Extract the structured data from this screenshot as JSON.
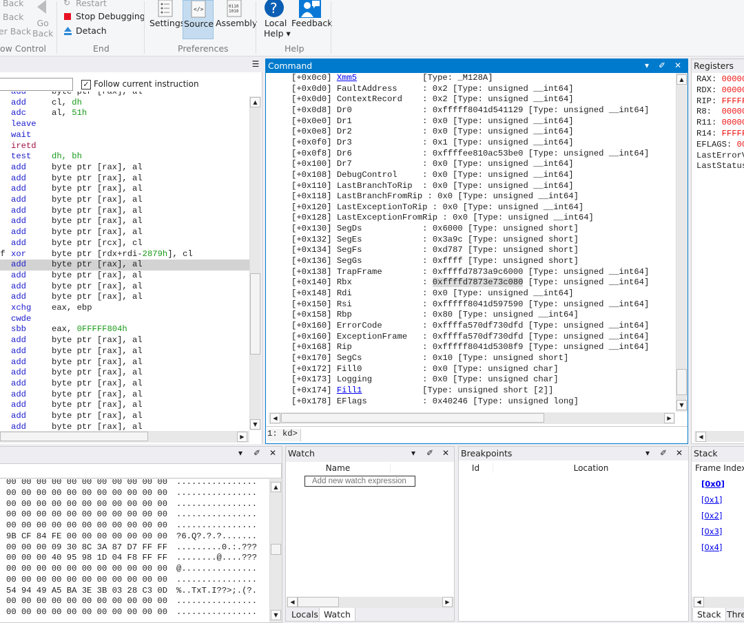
{
  "ribbon": {
    "flow_control": {
      "back1": "Back",
      "back2": "Back",
      "back3": "er Back",
      "go_back": "Go\nBack",
      "label": "ow Control"
    },
    "end": {
      "restart": "Restart",
      "stop": "Stop Debugging",
      "detach": "Detach",
      "label": "End"
    },
    "preferences": {
      "settings": "Settings",
      "source": "Source",
      "assembly": "Assembly",
      "label": "Preferences",
      "selected": "Source"
    },
    "help": {
      "local_help": "Local",
      "local_help2": "Help ▾",
      "feedback": "Feedback",
      "label": "Help"
    }
  },
  "disassembly": {
    "follow_label": "Follow current instruction",
    "follow_checked": true,
    "address_value": "",
    "highlight_index": 16,
    "rows": [
      {
        "p": "",
        "m": "add",
        "o": [
          [
            "byte ptr [rax], al",
            "n"
          ]
        ]
      },
      {
        "p": "",
        "m": "add",
        "o": [
          [
            "cl, ",
            "n"
          ],
          [
            "dh",
            "g"
          ]
        ]
      },
      {
        "p": "",
        "m": "adc",
        "o": [
          [
            "al, ",
            "n"
          ],
          [
            "51h",
            "g"
          ]
        ]
      },
      {
        "p": "",
        "m": "leave",
        "o": []
      },
      {
        "p": "",
        "m": "wait",
        "o": []
      },
      {
        "p": "",
        "m": "iretd",
        "k": "r",
        "o": []
      },
      {
        "p": "",
        "m": "test",
        "o": [
          [
            "dh, bh",
            "g"
          ]
        ]
      },
      {
        "p": "",
        "m": "add",
        "o": [
          [
            "byte ptr [rax], al",
            "n"
          ]
        ]
      },
      {
        "p": "",
        "m": "add",
        "o": [
          [
            "byte ptr [rax], al",
            "n"
          ]
        ]
      },
      {
        "p": "",
        "m": "add",
        "o": [
          [
            "byte ptr [rax], al",
            "n"
          ]
        ]
      },
      {
        "p": "",
        "m": "add",
        "o": [
          [
            "byte ptr [rax], al",
            "n"
          ]
        ]
      },
      {
        "p": "",
        "m": "add",
        "o": [
          [
            "byte ptr [rax], al",
            "n"
          ]
        ]
      },
      {
        "p": "",
        "m": "add",
        "o": [
          [
            "byte ptr [rax], al",
            "n"
          ]
        ]
      },
      {
        "p": "",
        "m": "add",
        "o": [
          [
            "byte ptr [rax], al",
            "n"
          ]
        ]
      },
      {
        "p": "",
        "m": "add",
        "o": [
          [
            "byte ptr [rcx], cl",
            "n"
          ]
        ]
      },
      {
        "p": "ff",
        "m": "xor",
        "o": [
          [
            "byte ptr [rdx+rdi-",
            "n"
          ],
          [
            "2879h",
            "g"
          ],
          [
            "], cl",
            "n"
          ]
        ]
      },
      {
        "p": "",
        "m": "add",
        "o": [
          [
            "byte ptr [rax], al",
            "n"
          ]
        ]
      },
      {
        "p": "",
        "m": "add",
        "o": [
          [
            "byte ptr [rax], al",
            "n"
          ]
        ]
      },
      {
        "p": "",
        "m": "add",
        "o": [
          [
            "byte ptr [rax], al",
            "n"
          ]
        ]
      },
      {
        "p": "",
        "m": "add",
        "o": [
          [
            "byte ptr [rax], al",
            "n"
          ]
        ]
      },
      {
        "p": "",
        "m": "xchg",
        "o": [
          [
            "eax, ebp",
            "n"
          ]
        ]
      },
      {
        "p": "",
        "m": "cwde",
        "o": []
      },
      {
        "p": "",
        "m": "sbb",
        "o": [
          [
            "eax, ",
            "n"
          ],
          [
            "0FFFFF804h",
            "g"
          ]
        ]
      },
      {
        "p": "",
        "m": "add",
        "o": [
          [
            "byte ptr [rax], al",
            "n"
          ]
        ]
      },
      {
        "p": "",
        "m": "add",
        "o": [
          [
            "byte ptr [rax], al",
            "n"
          ]
        ]
      },
      {
        "p": "",
        "m": "add",
        "o": [
          [
            "byte ptr [rax], al",
            "n"
          ]
        ]
      },
      {
        "p": "",
        "m": "add",
        "o": [
          [
            "byte ptr [rax], al",
            "n"
          ]
        ]
      },
      {
        "p": "",
        "m": "add",
        "o": [
          [
            "byte ptr [rax], al",
            "n"
          ]
        ]
      },
      {
        "p": "",
        "m": "add",
        "o": [
          [
            "byte ptr [rax], al",
            "n"
          ]
        ]
      },
      {
        "p": "",
        "m": "add",
        "o": [
          [
            "byte ptr [rax], al",
            "n"
          ]
        ]
      },
      {
        "p": "",
        "m": "add",
        "o": [
          [
            "byte ptr [rax], al",
            "n"
          ]
        ]
      },
      {
        "p": "",
        "m": "add",
        "o": [
          [
            "byte ptr [rax], al",
            "n"
          ]
        ]
      }
    ]
  },
  "command": {
    "title": "Command",
    "prompt": "1: kd>",
    "input_value": "",
    "selected_text": "0xffffd7873e73c080",
    "lines": [
      {
        "off": "+0x0c0",
        "name": "Xmm5",
        "link": true,
        "rest": "[Type: _M128A]"
      },
      {
        "off": "+0x0d0",
        "name": "FaultAddress",
        "rest": "0x2 [Type: unsigned __int64]"
      },
      {
        "off": "+0x0d0",
        "name": "ContextRecord",
        "rest": "0x2 [Type: unsigned __int64]"
      },
      {
        "off": "+0x0d8",
        "name": "Dr0",
        "rest": "0xfffff8041d541129 [Type: unsigned __int64]"
      },
      {
        "off": "+0x0e0",
        "name": "Dr1",
        "rest": "0x0 [Type: unsigned __int64]"
      },
      {
        "off": "+0x0e8",
        "name": "Dr2",
        "rest": "0x0 [Type: unsigned __int64]"
      },
      {
        "off": "+0x0f0",
        "name": "Dr3",
        "rest": "0x1 [Type: unsigned __int64]"
      },
      {
        "off": "+0x0f8",
        "name": "Dr6",
        "rest": "0xffffee810ac53be0 [Type: unsigned __int64]"
      },
      {
        "off": "+0x100",
        "name": "Dr7",
        "rest": "0x0 [Type: unsigned __int64]"
      },
      {
        "off": "+0x108",
        "name": "DebugControl",
        "rest": "0x0 [Type: unsigned __int64]"
      },
      {
        "off": "+0x110",
        "name": "LastBranchToRip",
        "rest": "0x0 [Type: unsigned __int64]"
      },
      {
        "off": "+0x118",
        "name": "LastBranchFromRip",
        "rest": "0x0 [Type: unsigned __int64]"
      },
      {
        "off": "+0x120",
        "name": "LastExceptionToRip",
        "rest": "0x0 [Type: unsigned __int64]"
      },
      {
        "off": "+0x128",
        "name": "LastExceptionFromRip",
        "rest": "0x0 [Type: unsigned __int64]"
      },
      {
        "off": "+0x130",
        "name": "SegDs",
        "rest": "0x6000 [Type: unsigned short]"
      },
      {
        "off": "+0x132",
        "name": "SegEs",
        "rest": "0x3a9c [Type: unsigned short]"
      },
      {
        "off": "+0x134",
        "name": "SegFs",
        "rest": "0xd787 [Type: unsigned short]"
      },
      {
        "off": "+0x136",
        "name": "SegGs",
        "rest": "0xffff [Type: unsigned short]"
      },
      {
        "off": "+0x138",
        "name": "TrapFrame",
        "rest": "0xffffd7873a9c6000 [Type: unsigned __int64]"
      },
      {
        "off": "+0x140",
        "name": "Rbx",
        "rest": "0xffffd7873e73c080 [Type: unsigned __int64]",
        "sel": true
      },
      {
        "off": "+0x148",
        "name": "Rdi",
        "rest": "0x0 [Type: unsigned __int64]"
      },
      {
        "off": "+0x150",
        "name": "Rsi",
        "rest": "0xfffff8041d597590 [Type: unsigned __int64]"
      },
      {
        "off": "+0x158",
        "name": "Rbp",
        "rest": "0x80 [Type: unsigned __int64]"
      },
      {
        "off": "+0x160",
        "name": "ErrorCode",
        "rest": "0xffffa570df730dfd [Type: unsigned __int64]"
      },
      {
        "off": "+0x160",
        "name": "ExceptionFrame",
        "rest": "0xffffa570df730dfd [Type: unsigned __int64]"
      },
      {
        "off": "+0x168",
        "name": "Rip",
        "rest": "0xfffff8041d5308f9 [Type: unsigned __int64]"
      },
      {
        "off": "+0x170",
        "name": "SegCs",
        "rest": "0x10 [Type: unsigned short]"
      },
      {
        "off": "+0x172",
        "name": "Fill0",
        "rest": "0x0 [Type: unsigned char]"
      },
      {
        "off": "+0x173",
        "name": "Logging",
        "rest": "0x0 [Type: unsigned char]"
      },
      {
        "off": "+0x174",
        "name": "Fill1",
        "link": true,
        "rest": "[Type: unsigned short [2]]"
      },
      {
        "off": "+0x178",
        "name": "EFlags",
        "rest": "0x40246 [Type: unsigned long]"
      }
    ]
  },
  "registers": {
    "title": "Registers",
    "rows": [
      {
        "name": "RAX: ",
        "value": "00000"
      },
      {
        "name": "RDX: ",
        "value": "00000"
      },
      {
        "name": "RIP: ",
        "value": "FFFFF"
      },
      {
        "name": "R8:  ",
        "value": "00000"
      },
      {
        "name": "R11: ",
        "value": "00000"
      },
      {
        "name": "R14: ",
        "value": "FFFFF"
      },
      {
        "name": "EFLAGS: ",
        "value": "00"
      },
      {
        "name": "LastErrorV",
        "value": ""
      },
      {
        "name": "LastStatus",
        "value": ""
      }
    ]
  },
  "memory": {
    "address_value": "",
    "rows": [
      {
        "hex": "00 00 00 00 00 00 00 00 00 00 00",
        "ascii": "................"
      },
      {
        "hex": "00 00 00 00 00 00 00 00 00 00 00",
        "ascii": "................"
      },
      {
        "hex": "00 00 00 00 00 00 00 00 00 00 00",
        "ascii": "................"
      },
      {
        "hex": "00 00 00 00 00 00 00 00 00 00 00",
        "ascii": "................"
      },
      {
        "hex": "00 00 00 00 00 00 00 00 00 00 00",
        "ascii": "................"
      },
      {
        "hex": "9B CF 84 FE 00 00 00 00 00 00 00",
        "ascii": "?6.Q?.?.?......."
      },
      {
        "hex": "00 00 00 09 30 8C 3A 87 D7 FF FF",
        "ascii": ".........0.:.???"
      },
      {
        "hex": "00 00 00 40 95 98 1D 04 F8 FF FF",
        "ascii": "........@....???"
      },
      {
        "hex": "00 00 00 00 00 00 00 00 00 00 00",
        "ascii": "@..............."
      },
      {
        "hex": "00 00 00 00 00 00 00 00 00 00 00",
        "ascii": "................"
      },
      {
        "hex": "54 94 49 A5 BA 3E 3B 03 28 C3 0D",
        "ascii": "%..TxT.I??>;.(?."
      },
      {
        "hex": "00 00 00 00 00 00 00 00 00 00 00",
        "ascii": "................"
      },
      {
        "hex": "00 00 00 00 00 00 00 00 00 00 00",
        "ascii": "................"
      }
    ]
  },
  "watch": {
    "title": "Watch",
    "col_name": "Name",
    "placeholder": "Add new watch expression",
    "tabs": [
      "Locals",
      "Watch"
    ],
    "selected_tab": "Watch"
  },
  "breakpoints": {
    "title": "Breakpoints",
    "col_id": "Id",
    "col_location": "Location"
  },
  "stack": {
    "title": "Stack",
    "col_frame": "Frame Index",
    "frames": [
      "[0x0]",
      "[0x1]",
      "[0x2]",
      "[0x3]",
      "[0x4]"
    ],
    "tabs": [
      "Stack",
      "Thre"
    ]
  },
  "icons": {
    "dropdown": "▾",
    "pin": "✐",
    "close": "✕"
  },
  "colors": {
    "accent": "#007acc",
    "register_value": "#ee1111",
    "selected_ribbon": "#c5dcf0"
  }
}
